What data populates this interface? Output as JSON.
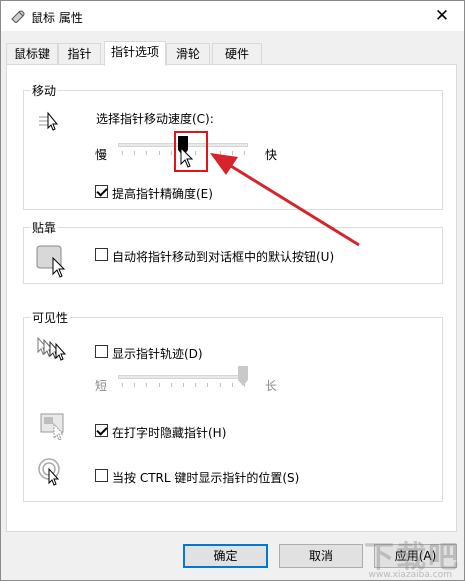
{
  "window": {
    "title": "鼠标 属性",
    "close_glyph": "✕"
  },
  "tabs": [
    {
      "label": "鼠标键"
    },
    {
      "label": "指针"
    },
    {
      "label": "指针选项",
      "active": true
    },
    {
      "label": "滑轮"
    },
    {
      "label": "硬件"
    }
  ],
  "motion": {
    "group_label": "移动",
    "speed_label": "选择指针移动速度(C):",
    "slow_label": "慢",
    "fast_label": "快",
    "speed_level": 0.5,
    "enhance_label": "提高指针精确度(E)",
    "enhance_checked": true
  },
  "snap": {
    "group_label": "贴靠",
    "snap_label": "自动将指针移动到对话框中的默认按钮(U)",
    "snap_checked": false
  },
  "visibility": {
    "group_label": "可见性",
    "trails_label": "显示指针轨迹(D)",
    "trails_checked": false,
    "short_label": "短",
    "long_label": "长",
    "trails_level": 1.0,
    "hide_label": "在打字时隐藏指针(H)",
    "hide_checked": true,
    "show_loc_label": "当按 CTRL 键时显示指针的位置(S)",
    "show_loc_checked": false
  },
  "buttons": {
    "ok": "确定",
    "cancel": "取消",
    "apply": "应用(A)"
  },
  "watermark": {
    "big": "下载吧",
    "small": "www.xiazaiba.com"
  },
  "colors": {
    "highlight_box": "#e0141b",
    "arrow": "#d9232a",
    "accent": "#0078d7"
  }
}
